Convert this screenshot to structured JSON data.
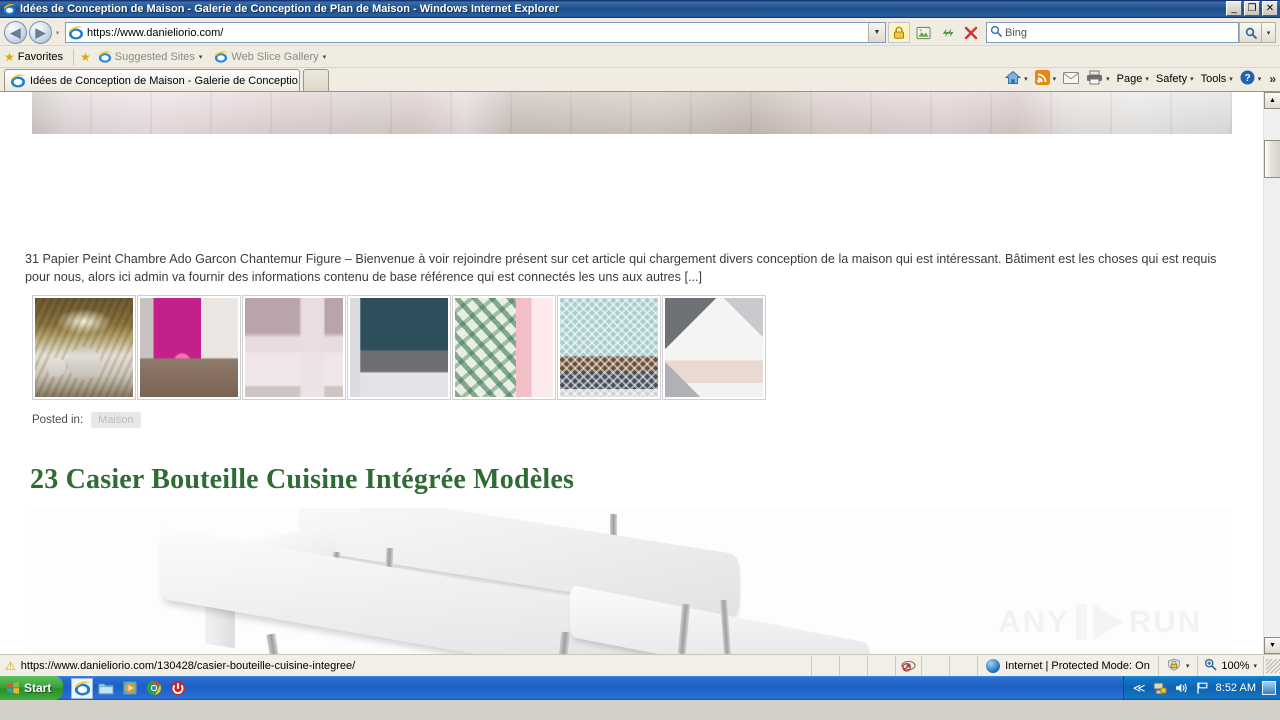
{
  "window": {
    "title": "Idées de Conception de Maison - Galerie de Conception de Plan de Maison - Windows Internet Explorer",
    "minimize": "_",
    "maximize": "❐",
    "close": "✕"
  },
  "nav": {
    "back": "◀",
    "forward": "▶",
    "history_caret": "▾",
    "url": "https://www.danieliorio.com/",
    "address_dropdown": "▼",
    "compat_icon": "compatibility-view-icon",
    "refresh_icon": "refresh-icon",
    "stop_icon": "stop-icon",
    "lock_icon": "lock-icon"
  },
  "search": {
    "placeholder": "Bing",
    "magnifier": "search-icon",
    "go": "🔍",
    "dropdown": "▾"
  },
  "favorites_bar": {
    "favorites_label": "Favorites",
    "add_icon": "add-to-favorites-icon",
    "items": [
      {
        "label": "Suggested Sites",
        "caret": "▾"
      },
      {
        "label": "Web Slice Gallery",
        "caret": "▾"
      }
    ]
  },
  "tabs": [
    {
      "label": "Idées de Conception de Maison - Galerie de Conceptio..."
    }
  ],
  "new_tab_label": "",
  "command_bar": {
    "home_caret": "▾",
    "feeds_caret": "▾",
    "print_caret": "▾",
    "items": [
      {
        "label": "Page",
        "caret": "▾"
      },
      {
        "label": "Safety",
        "caret": "▾"
      },
      {
        "label": "Tools",
        "caret": "▾"
      }
    ],
    "help_caret": "▾",
    "overflow": "»"
  },
  "page": {
    "excerpt": "31 Papier Peint Chambre Ado Garcon Chantemur Figure – Bienvenue à voir rejoindre présent sur cet article qui chargement divers conception de la maison qui est intéressant. Bâtiment est les choses qui est requis pour nous, alors ici admin va fournir des informations contenu de base référence qui est connectés les uns aux autres [...]",
    "posted_in_label": "Posted in:",
    "category_tag": "Maison",
    "article_heading": "23 Casier Bouteille Cuisine Intégrée Modèles",
    "thumbnails": [
      {
        "name": "chambre-papier-peint-dore"
      },
      {
        "name": "chambre-rose-fuchsia"
      },
      {
        "name": "chambre-mauve-armoire"
      },
      {
        "name": "chambre-bleu-canard"
      },
      {
        "name": "papier-peint-feuillage-tropical"
      },
      {
        "name": "papier-peint-turquoise-geometrique"
      },
      {
        "name": "papier-peint-triangles-scandinave"
      }
    ],
    "watermark": {
      "left": "ANY",
      "right": "RUN"
    }
  },
  "scrollbar": {
    "up": "▲",
    "down": "▼"
  },
  "status_bar": {
    "link_url": "https://www.danieliorio.com/130428/casier-bouteille-cuisine-integree/",
    "warning_icon": "warning-icon",
    "privacy_icon": "privacy-report-icon",
    "zone": "Internet | Protected Mode: On",
    "zone_icon": "internet-zone-icon",
    "zone_caret": "▾",
    "zoom_level": "100%",
    "zoom_icon": "zoom-icon",
    "zoom_caret": "▾"
  },
  "taskbar": {
    "start_label": "Start",
    "quick_launch": [
      {
        "name": "internet-explorer-icon",
        "glyph": "e"
      },
      {
        "name": "folder-icon",
        "glyph": "▭"
      },
      {
        "name": "media-player-icon",
        "glyph": "▶"
      },
      {
        "name": "chrome-icon",
        "glyph": "◉"
      },
      {
        "name": "shutdown-icon",
        "glyph": "❶"
      }
    ],
    "tray": {
      "expand": "≪",
      "network_icon": "network-icon",
      "volume_icon": "volume-icon",
      "flag_icon": "action-center-icon",
      "clock": "8:52 AM",
      "show_desktop": "show-desktop-button"
    }
  },
  "colors": {
    "heading_green": "#2f6b35",
    "title_blue": "#1f4e8c",
    "taskbar_blue": "#1d5fc4",
    "start_green": "#3ca33c"
  }
}
